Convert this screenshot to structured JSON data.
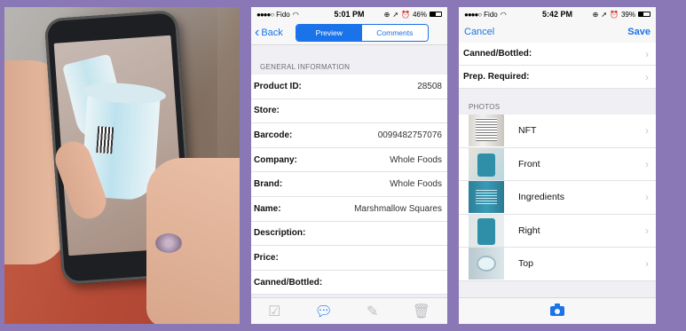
{
  "preview_screen": {
    "status": {
      "carrier": "Fido",
      "time": "5:01 PM",
      "battery": "46%",
      "battery_level": 0.46
    },
    "nav": {
      "back_label": "Back",
      "tabs": [
        {
          "label": "Preview",
          "selected": true
        },
        {
          "label": "Comments",
          "selected": false
        }
      ]
    },
    "section_header": "GENERAL INFORMATION",
    "fields": [
      {
        "label": "Product ID:",
        "value": "28508"
      },
      {
        "label": "Store:",
        "value": ""
      },
      {
        "label": "Barcode:",
        "value": "0099482757076"
      },
      {
        "label": "Company:",
        "value": "Whole Foods"
      },
      {
        "label": "Brand:",
        "value": "Whole Foods"
      },
      {
        "label": "Name:",
        "value": "Marshmallow Squares"
      },
      {
        "label": "Description:",
        "value": ""
      },
      {
        "label": "Price:",
        "value": ""
      },
      {
        "label": "Canned/Bottled:",
        "value": ""
      }
    ],
    "toolbar_icons": [
      "checkbox-icon",
      "comment-icon",
      "edit-icon",
      "trash-icon"
    ]
  },
  "edit_screen": {
    "status": {
      "carrier": "Fido",
      "time": "5:42 PM",
      "battery": "39%",
      "battery_level": 0.39
    },
    "nav": {
      "cancel_label": "Cancel",
      "save_label": "Save"
    },
    "fields": [
      {
        "label": "Canned/Bottled:"
      },
      {
        "label": "Prep. Required:"
      }
    ],
    "photos_header": "PHOTOS",
    "photos": [
      {
        "label": "NFT",
        "thumb": "t0"
      },
      {
        "label": "Front",
        "thumb": "t1"
      },
      {
        "label": "Ingredients",
        "thumb": "t2"
      },
      {
        "label": "Right",
        "thumb": "t3"
      },
      {
        "label": "Top",
        "thumb": "t4"
      }
    ],
    "footer_icon": "camera-icon"
  },
  "colors": {
    "accent": "#1a73e8",
    "background": "#8a77b6"
  }
}
